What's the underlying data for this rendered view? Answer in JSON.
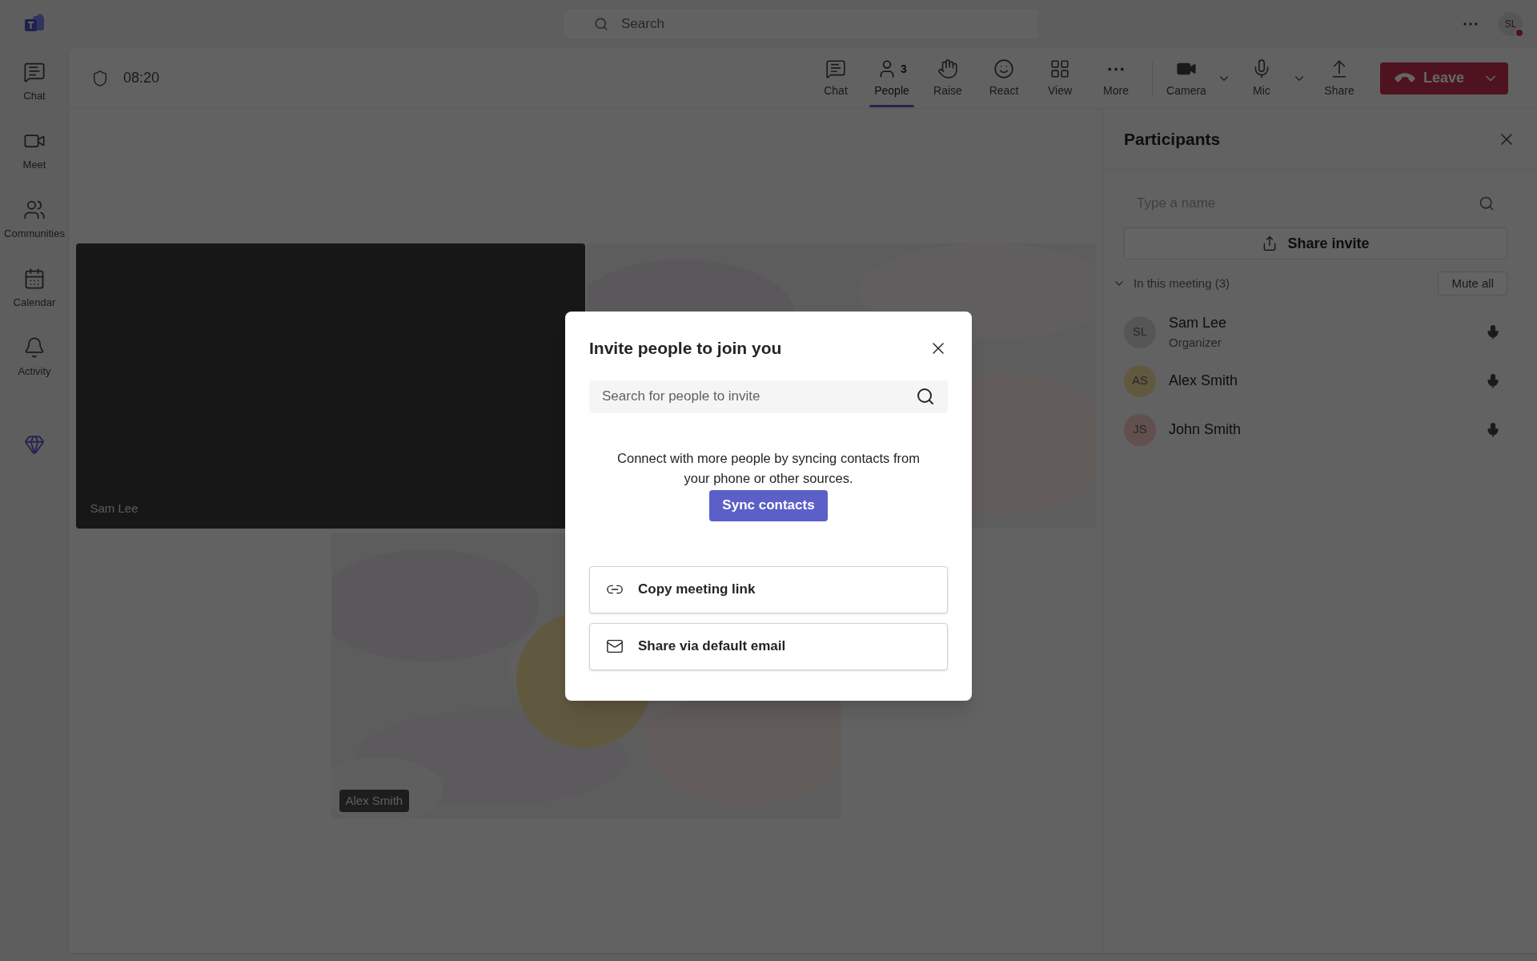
{
  "app_bar": {
    "search_placeholder": "Search",
    "avatar": {
      "initials": "SL",
      "busy": true
    }
  },
  "rail": [
    {
      "label": "Chat"
    },
    {
      "label": "Meet"
    },
    {
      "label": "Communities"
    },
    {
      "label": "Calendar"
    },
    {
      "label": "Activity"
    }
  ],
  "meeting": {
    "timer": "08:20",
    "toolbar": [
      {
        "kind": "tool",
        "label": "Chat",
        "selected": false
      },
      {
        "kind": "tool",
        "label": "People",
        "count": "3",
        "selected": true
      },
      {
        "kind": "tool",
        "label": "Raise",
        "selected": false
      },
      {
        "kind": "tool",
        "label": "React",
        "selected": false
      },
      {
        "kind": "tool",
        "label": "View",
        "selected": false
      },
      {
        "kind": "tool",
        "label": "More",
        "selected": false
      },
      {
        "kind": "split",
        "label": "Camera",
        "selected": false
      },
      {
        "kind": "split",
        "label": "Mic",
        "selected": false
      },
      {
        "kind": "tool",
        "label": "Share",
        "selected": false
      },
      {
        "kind": "leave",
        "label": "Leave"
      }
    ]
  },
  "tiles": [
    {
      "kind": "camera_off",
      "name": "Sam Lee"
    },
    {
      "kind": "picture"
    },
    {
      "kind": "avatar",
      "name": "Alex Smith"
    }
  ],
  "participants": {
    "title": "Participants",
    "search_placeholder": "Type a name",
    "share_button": "Share invite",
    "section": {
      "label": "In this meeting (3)",
      "expanded": true,
      "action": "Mute all"
    },
    "people": [
      {
        "initials": "SL",
        "name": "Sam Lee",
        "role": "Organizer"
      },
      {
        "initials": "AS",
        "name": "Alex Smith"
      },
      {
        "initials": "JS",
        "name": "John Smith"
      }
    ]
  },
  "dialog": {
    "title": "Invite people to join you",
    "search_placeholder": "Search for people to invite",
    "message": "Connect with more people by syncing contacts from your phone or other sources.",
    "sync_button": "Sync contacts",
    "options": [
      {
        "kind": "link",
        "label": "Copy meeting link"
      },
      {
        "kind": "email",
        "label": "Share via default email"
      }
    ]
  }
}
